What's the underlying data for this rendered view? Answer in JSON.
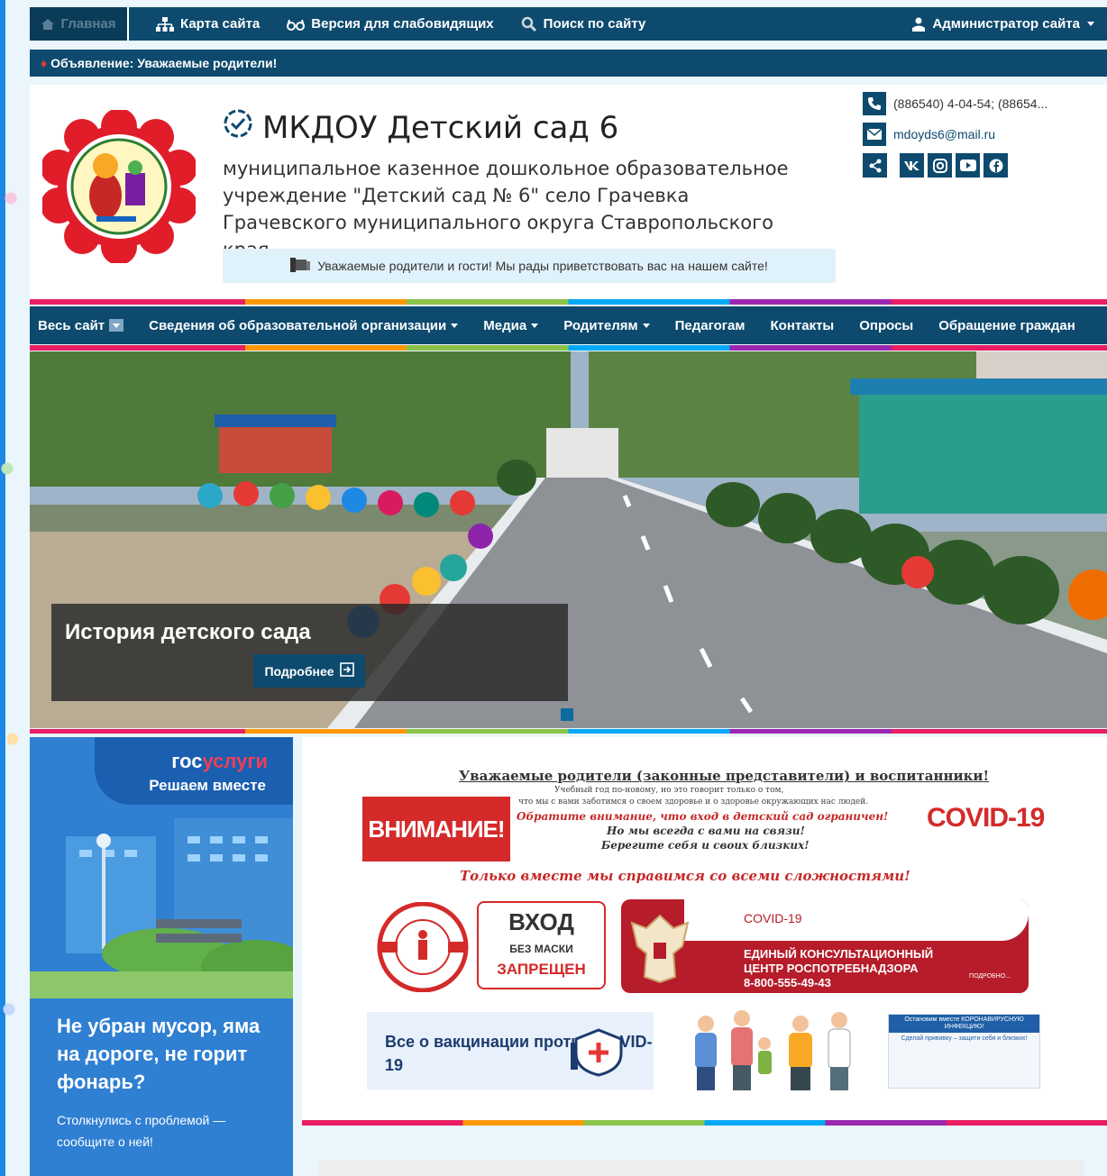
{
  "topbar": {
    "home": "Главная",
    "sitemap": "Карта сайта",
    "accessibility": "Версия для слабовидящих",
    "search": "Поиск по сайту",
    "admin": "Администратор сайта"
  },
  "announcement": "Объявление: Уважаемые родители!",
  "header": {
    "title": "МКДОУ Детский сад 6",
    "subtitle": "муниципальное казенное дошкольное образовательное учреждение \"Детский сад № 6\" село Грачевка Грачевского муниципального округа Ставропольского края",
    "welcome": "Уважаемые родители и гости! Мы рады приветствовать вас на нашем сайте!",
    "phone": "(886540) 4-04-54; (88654...",
    "email": "mdoyds6@mail.ru"
  },
  "nav": {
    "all": "Весь сайт",
    "info": "Сведения об образовательной организации",
    "media": "Медиа",
    "parents": "Родителям",
    "teachers": "Педагогам",
    "contacts": "Контакты",
    "polls": "Опросы",
    "appeals": "Обращение граждан"
  },
  "slider": {
    "caption": "История детского сада",
    "more": "Подробнее"
  },
  "gos": {
    "brand_a": "гос",
    "brand_b": "услуги",
    "tag": "Решаем вместе",
    "question": "Не убран мусор, яма на дороге, не горит фонарь?",
    "small": "Столкнулись с проблемой — сообщите о ней!"
  },
  "covid": {
    "head": "Уважаемые родители (законные представители) и воспитанники!",
    "line1": "Учебный год по-новому, но это говорит только о том,",
    "line2": "что мы с вами заботимся о своем здоровье и о здоровье окружающих нас людей.",
    "line3": "Обратите внимание, что вход в детский сад ограничен!",
    "line4": "Но мы всегда с вами на связи!",
    "line5": "Берегите себя и своих близких!",
    "line6": "Только вместе мы справимся со всеми сложностями!",
    "attention": "ВНИМАНИЕ!",
    "covid19": "COVID-19",
    "entry1": "ВХОД",
    "entry2": "БЕЗ МАСКИ",
    "entry3": "ЗАПРЕЩЕН",
    "rpn1": "COVID-19",
    "rpn2": "ЕДИНЫЙ КОНСУЛЬТАЦИОННЫЙ ЦЕНТР РОСПОТРЕБНАДЗОРА",
    "rpn3": "8-800-555-49-43",
    "rpn_more": "ПОДРОБНО...",
    "vaccine": "Все о вакцинации против COVID-19",
    "poster_head": "Остановим вместе КОРОНАВИРУСНУЮ ИНФЕКЦИЮ!",
    "poster_sub": "Сделай прививку – защити себя и близких!"
  },
  "colors": {
    "navy": "#0d4a6e",
    "red": "#d42a2a",
    "gos_blue": "#2f7fd2"
  }
}
